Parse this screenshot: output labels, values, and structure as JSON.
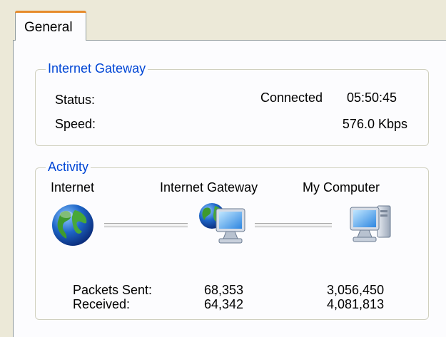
{
  "tabs": [
    {
      "label": "General",
      "selected": true
    }
  ],
  "internet_gateway": {
    "title": "Internet Gateway",
    "status_label": "Status:",
    "status_value": "Connected",
    "duration": "05:50:45",
    "speed_label": "Speed:",
    "speed_value": "576.0 Kbps"
  },
  "activity": {
    "title": "Activity",
    "nodes": {
      "internet": "Internet",
      "gateway": "Internet Gateway",
      "computer": "My Computer"
    },
    "packets_sent_label": "Packets Sent:",
    "received_label": "Received:",
    "gateway_sent": "68,353",
    "gateway_received": "64,342",
    "computer_sent": "3,056,450",
    "computer_received": "4,081,813"
  },
  "icons": {
    "internet": "globe-icon",
    "gateway": "gateway-computer-icon",
    "computer": "computer-icon"
  },
  "colors": {
    "group_title": "#0046D5",
    "tab_highlight": "#E68B2C",
    "window_bg": "#ECE9D8",
    "panel_bg": "#FCFCFE"
  }
}
